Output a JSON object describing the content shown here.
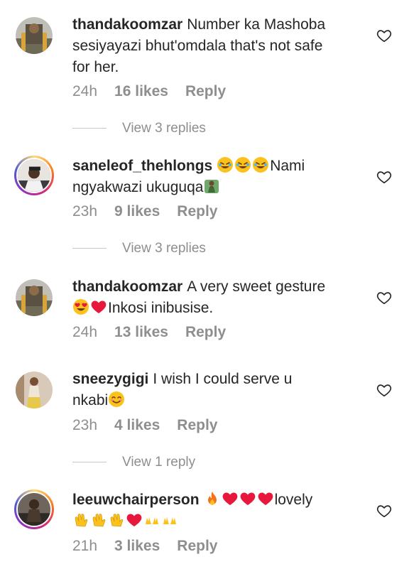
{
  "comments": [
    {
      "username": "thandakoomzar",
      "text_line1": "Number ka Mashoba",
      "text_line2": "sesiyayazi bhut'omdala that's not safe",
      "text_line3": "for her.",
      "time": "24h",
      "likes": "16 likes",
      "reply": "Reply",
      "view_replies": "View 3 replies"
    },
    {
      "username": "saneleof_thehlongs",
      "text_after_emoji": "Nami",
      "text_line2": "ngyakwazi ukuguqa",
      "time": "23h",
      "likes": "9 likes",
      "reply": "Reply",
      "view_replies": "View 3 replies"
    },
    {
      "username": "thandakoomzar",
      "text_line1": "A very sweet gesture",
      "text_line2": "Inkosi inibusise.",
      "time": "24h",
      "likes": "13 likes",
      "reply": "Reply"
    },
    {
      "username": "sneezygigi",
      "text_line1": "I wish I could serve u",
      "text_line2": "nkabi",
      "time": "23h",
      "likes": "4 likes",
      "reply": "Reply",
      "view_replies": "View 1 reply"
    },
    {
      "username": "leeuwchairperson",
      "text_line1": "lovely",
      "time": "21h",
      "likes": "3 likes",
      "reply": "Reply"
    }
  ],
  "icons": {
    "like": "heart-outline-icon",
    "laugh": "rolling-laughing-emoji",
    "kneel": "person-kneeling-emoji",
    "heart_eyes": "heart-eyes-emoji",
    "red_heart": "red-heart-emoji",
    "smile": "smiling-face-emoji",
    "fire": "fire-emoji",
    "clap": "clapping-hands-emoji",
    "raised_hands": "raising-hands-emoji"
  },
  "colors": {
    "text": "#262626",
    "secondary": "#8e8e8e",
    "heart": "#e8173c",
    "divider": "#c7c7c7"
  }
}
